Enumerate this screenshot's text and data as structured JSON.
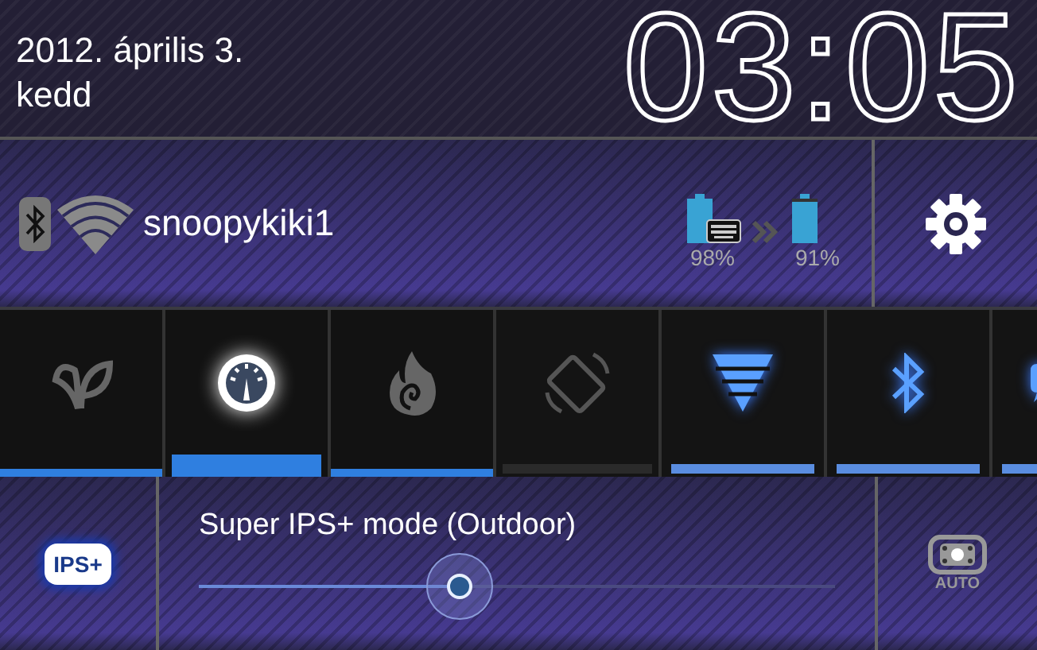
{
  "header": {
    "date": "2012. április 3.",
    "weekday": "kedd",
    "clock": "03:05"
  },
  "status": {
    "network": "snoopykiki1",
    "batteries": [
      {
        "reading": "98%",
        "level": 0.98
      },
      {
        "reading": "91%",
        "level": 0.91
      }
    ]
  },
  "toggles": [
    {
      "kind": "mode",
      "selected": false
    },
    {
      "kind": "mode",
      "selected": true
    },
    {
      "kind": "mode",
      "selected": false
    },
    {
      "kind": "switch",
      "on": false
    },
    {
      "kind": "switch",
      "on": true
    },
    {
      "kind": "switch",
      "on": true
    },
    {
      "kind": "switch",
      "on": true
    }
  ],
  "display": {
    "badge": "IPS+",
    "label": "Super IPS+ mode (Outdoor)",
    "level": 0.41,
    "auto_label": "AUTO"
  }
}
